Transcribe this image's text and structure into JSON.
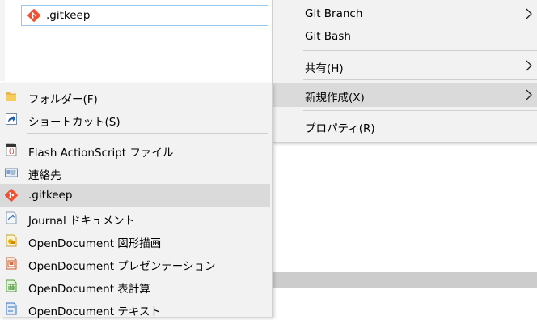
{
  "explorer": {
    "selected_file_name": ".gitkeep"
  },
  "parent_menu": {
    "items": [
      {
        "label": "Git Branch"
      },
      {
        "label": "Git Bash"
      },
      {
        "label": "共有(H)"
      },
      {
        "label": "新規作成(X)"
      },
      {
        "label": "プロパティ(R)"
      }
    ]
  },
  "submenu": {
    "items": [
      {
        "label": "フォルダー(F)",
        "icon": "folder-icon"
      },
      {
        "label": "ショートカット(S)",
        "icon": "shortcut-icon"
      },
      {
        "label": "Flash ActionScript ファイル",
        "icon": "actionscript-file-icon"
      },
      {
        "label": "連絡先",
        "icon": "contact-card-icon"
      },
      {
        "label": ".gitkeep",
        "icon": "git-icon"
      },
      {
        "label": "Journal ドキュメント",
        "icon": "journal-document-icon"
      },
      {
        "label": "OpenDocument 図形描画",
        "icon": "odf-drawing-icon"
      },
      {
        "label": "OpenDocument プレゼンテーション",
        "icon": "odf-presentation-icon"
      },
      {
        "label": "OpenDocument 表計算",
        "icon": "odf-spreadsheet-icon"
      },
      {
        "label": "OpenDocument テキスト",
        "icon": "odf-text-icon"
      }
    ]
  },
  "colors": {
    "menu_bg": "#f2f2f2",
    "highlight": "#dadada",
    "separator": "#cfcfcf",
    "git_orange": "#f05133",
    "selection_border": "#99c9ef"
  }
}
